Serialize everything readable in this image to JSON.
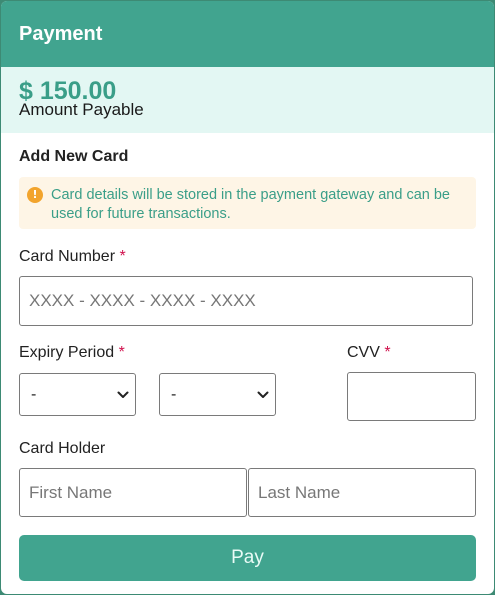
{
  "modal": {
    "title": "Payment"
  },
  "amount": {
    "value": "$ 150.00",
    "label": "Amount Payable"
  },
  "card_form": {
    "section_title": "Add New Card",
    "notice": "Card details will be stored in the payment gateway and can be used for future transactions.",
    "card_number": {
      "label": "Card Number",
      "required": "*",
      "placeholder": "XXXX - XXXX - XXXX - XXXX",
      "value": ""
    },
    "expiry": {
      "label": "Expiry Period",
      "required": "*",
      "month_value": "-",
      "year_value": "-"
    },
    "cvv": {
      "label": "CVV",
      "required": "*",
      "value": ""
    },
    "card_holder": {
      "label": "Card Holder",
      "first_placeholder": "First Name",
      "last_placeholder": "Last Name"
    },
    "pay_label": "Pay"
  },
  "icons": {
    "notice_icon": "info-icon",
    "select_icon": "chevron-down-icon"
  },
  "colors": {
    "accent": "#41a48f",
    "required": "#d0104c",
    "notice_bg": "#fef5e6",
    "amount_bg": "#e3f7f3"
  }
}
